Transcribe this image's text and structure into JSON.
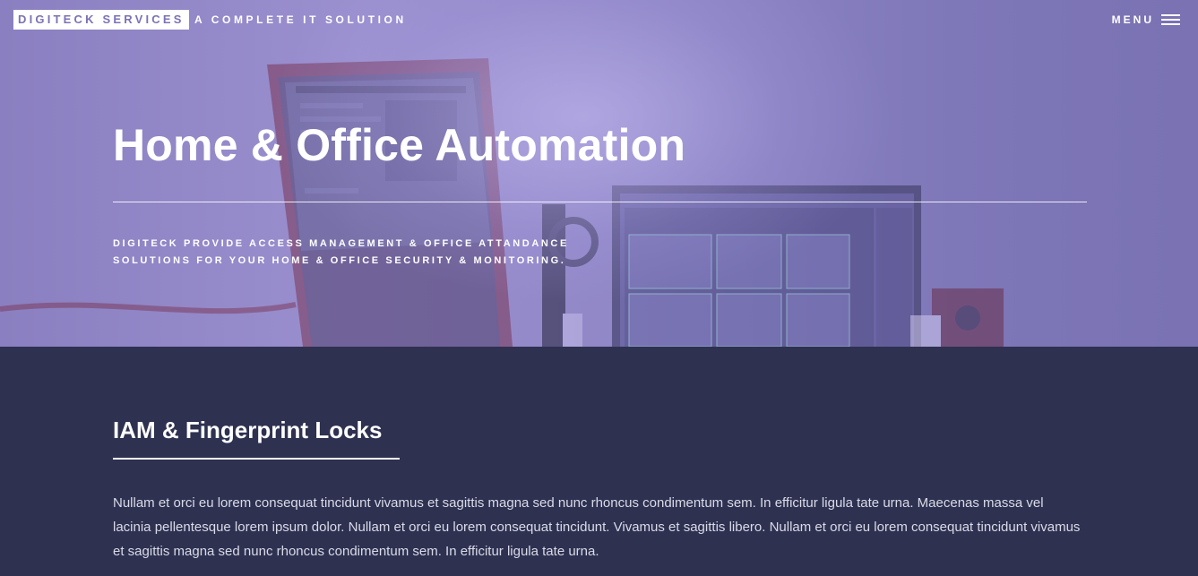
{
  "header": {
    "brand": "DIGITECK SERVICES",
    "tagline": "A COMPLETE IT SOLUTION",
    "menu_label": "MENU",
    "menu_icon": "hamburger-icon"
  },
  "hero": {
    "title": "Home & Office Automation",
    "subtitle": "DIGITECK PROVIDE ACCESS MANAGEMENT & OFFICE ATTANDANCE SOLUTIONS FOR YOUR HOME & OFFICE SECURITY & MONITORING."
  },
  "section": {
    "title": "IAM & Fingerprint Locks",
    "body": "Nullam et orci eu lorem consequat tincidunt vivamus et sagittis magna sed nunc rhoncus condimentum sem. In efficitur ligula tate urna. Maecenas massa vel lacinia pellentesque lorem ipsum dolor. Nullam et orci eu lorem consequat tincidunt. Vivamus et sagittis libero. Nullam et orci eu lorem consequat tincidunt vivamus et sagittis magna sed nunc rhoncus condimentum sem. In efficitur ligula tate urna."
  },
  "colors": {
    "hero_overlay": "#8a7fc0",
    "content_background": "#2e3150",
    "brand_text": "#7c72b6",
    "text": "#ffffff"
  }
}
